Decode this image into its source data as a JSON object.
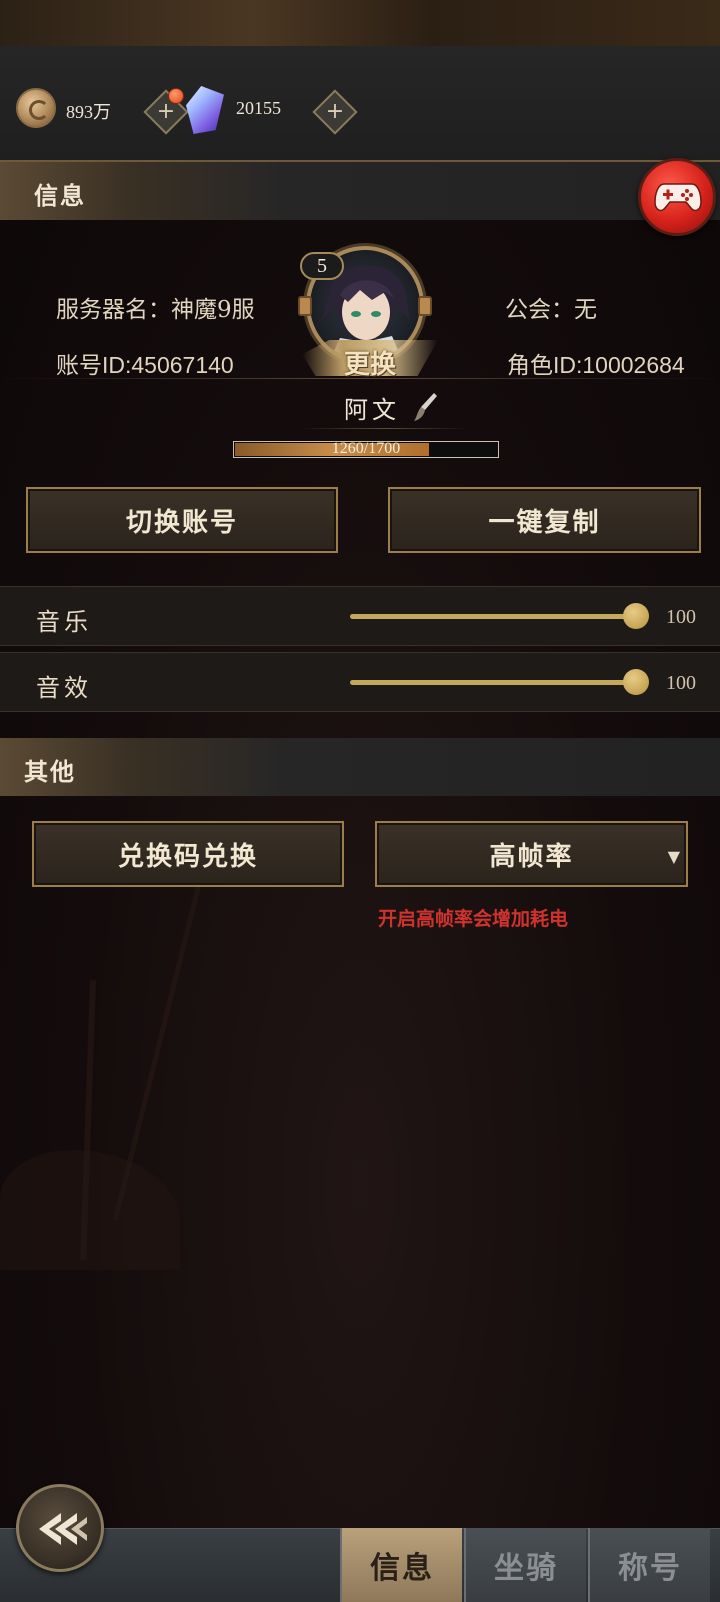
{
  "currency": {
    "coins": "893万",
    "gems": "20155"
  },
  "info_section": {
    "title": "信息",
    "server_label": "服务器名：神魔9服",
    "guild_label": "公会：无",
    "account_id": "账号ID:45067140",
    "role_id": "角色ID:10002684",
    "level": "5",
    "change_label": "更换",
    "player_name": "阿文",
    "exp_text": "1260/1700",
    "exp_progress": 0.741
  },
  "buttons": {
    "switch_account": "切换账号",
    "copy_all": "一键复制"
  },
  "audio": {
    "music_label": "音乐",
    "music_value": "100",
    "sfx_label": "音效",
    "sfx_value": "100"
  },
  "other_section": {
    "title": "其他",
    "redeem_button": "兑换码兑换",
    "framerate_select": "高帧率",
    "framerate_warning": "开启高帧率会增加耗电"
  },
  "tabs": [
    {
      "label": "信息",
      "active": true
    },
    {
      "label": "坐骑",
      "active": false
    },
    {
      "label": "称号",
      "active": false
    }
  ],
  "colors": {
    "accent_gold": "#c5a75d",
    "warning_red": "#d0332d",
    "gamepad_red": "#d6221a"
  },
  "icons": {
    "coin": "coin-icon",
    "gem": "crystal-icon",
    "gamepad": "gamepad-icon",
    "edit": "brush-icon",
    "back": "back-arrow-icon"
  }
}
